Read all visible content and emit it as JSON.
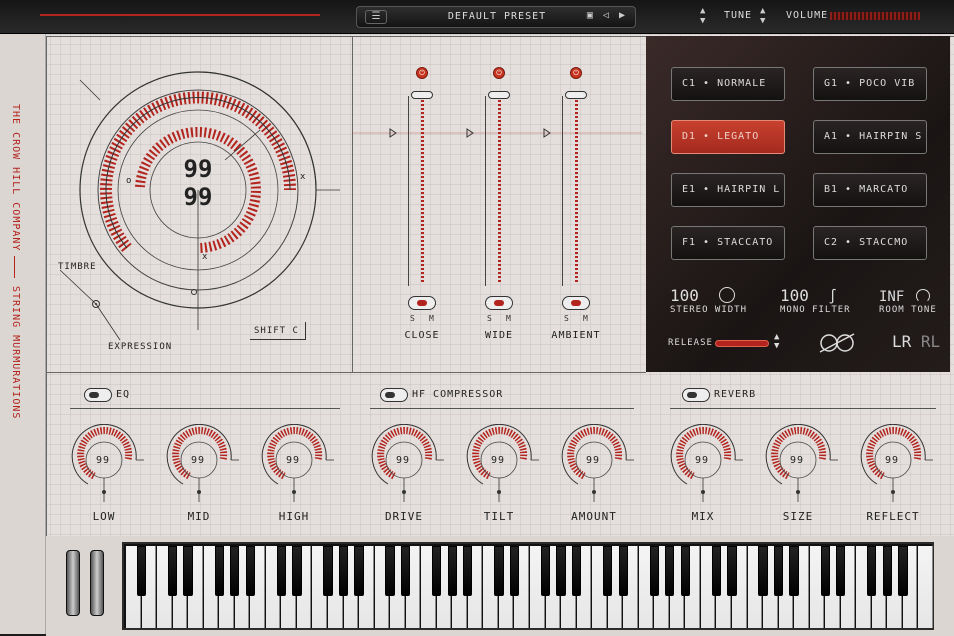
{
  "topbar": {
    "menu_icon": "hamburger-icon",
    "preset_name": "DEFAULT PRESET",
    "preset_nav": "▣ ◁ ▶",
    "tune_label": "TUNE",
    "volume_label": "VOLUME",
    "accent_color": "#b3241e"
  },
  "sidebar": {
    "brand_text": "THE CROW HILL COMPANY",
    "product_text": "STRING MURMURATIONS"
  },
  "main_dial": {
    "value_top": "99",
    "value_bottom": "99",
    "timbre_label": "TIMBRE",
    "expression_label": "EXPRESSION",
    "shift_label": "SHIFT  C",
    "x_mark": "x",
    "o_mark": "o"
  },
  "mics": [
    {
      "name": "CLOSE",
      "s": "S",
      "m": "M"
    },
    {
      "name": "WIDE",
      "s": "S",
      "m": "M"
    },
    {
      "name": "AMBIENT",
      "s": "S",
      "m": "M"
    }
  ],
  "articulations": [
    {
      "label": "C1 • NORMALE",
      "active": false
    },
    {
      "label": "G1 • POCO VIB",
      "active": false
    },
    {
      "label": "D1 • LEGATO",
      "active": true
    },
    {
      "label": "A1 • HAIRPIN S",
      "active": false
    },
    {
      "label": "E1 • HAIRPIN L",
      "active": false
    },
    {
      "label": "B1 • MARCATO",
      "active": false
    },
    {
      "label": "F1 • STACCATO",
      "active": false
    },
    {
      "label": "C2 • STACCMO",
      "active": false
    }
  ],
  "stats": {
    "stereo_width_value": "100",
    "stereo_width_label": "STEREO WIDTH",
    "mono_filter_value": "100",
    "mono_filter_label": "MONO FILTER",
    "room_tone_value": "INF",
    "room_tone_label": "ROOM TONE",
    "release_label": "RELEASE",
    "lr_label": "LR",
    "rl_label": "RL"
  },
  "fx": {
    "eq_title": "EQ",
    "comp_title": "HF COMPRESSOR",
    "reverb_title": "REVERB",
    "knobs": [
      {
        "label": "LOW",
        "value": "99"
      },
      {
        "label": "MID",
        "value": "99"
      },
      {
        "label": "HIGH",
        "value": "99"
      },
      {
        "label": "DRIVE",
        "value": "99"
      },
      {
        "label": "TILT",
        "value": "99"
      },
      {
        "label": "AMOUNT",
        "value": "99"
      },
      {
        "label": "MIX",
        "value": "99"
      },
      {
        "label": "SIZE",
        "value": "99"
      },
      {
        "label": "REFLECT",
        "value": "99"
      }
    ]
  }
}
